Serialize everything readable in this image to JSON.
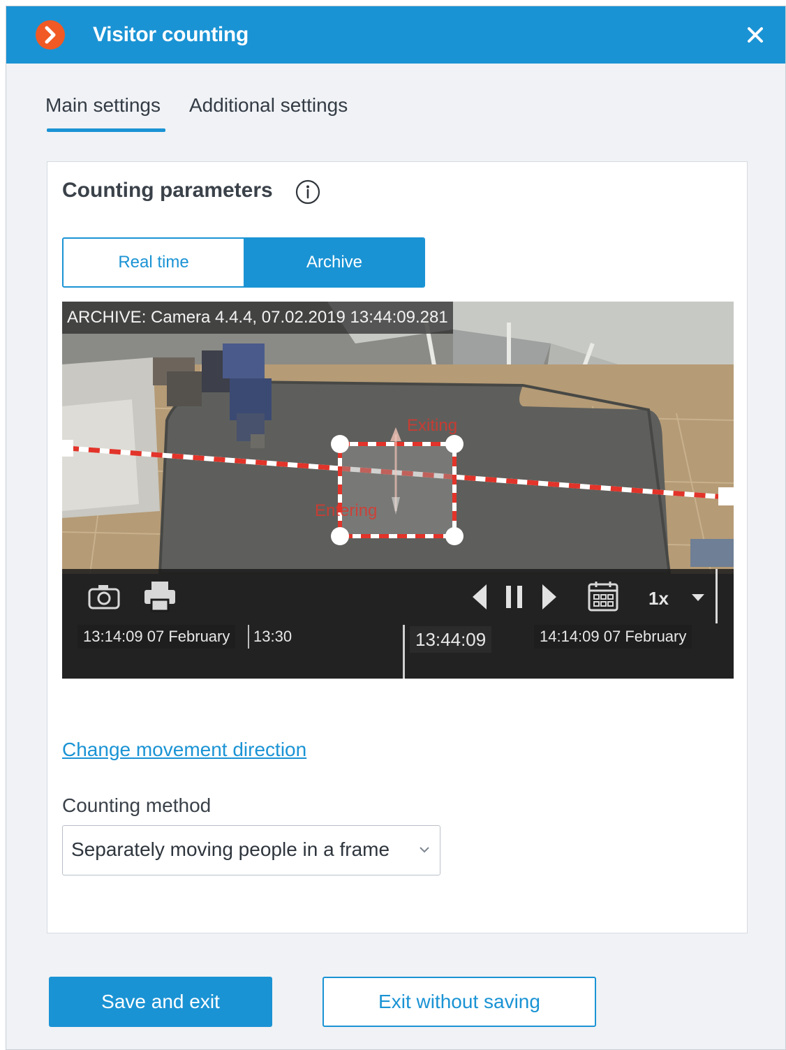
{
  "window": {
    "title": "Visitor counting",
    "accent_color": "#1a93d4",
    "logo_color": "#f15a24",
    "close_icon": "close-icon"
  },
  "tabs": [
    {
      "label": "Main settings",
      "active": true
    },
    {
      "label": "Additional settings",
      "active": false
    }
  ],
  "panel": {
    "title": "Counting parameters",
    "info_icon": "info-icon"
  },
  "mode_toggle": {
    "options": [
      {
        "label": "Real time",
        "selected": false
      },
      {
        "label": "Archive",
        "selected": true
      }
    ]
  },
  "video": {
    "camera_label": "ARCHIVE: Camera 4.4.4, 07.02.2019 13:44:09.281",
    "zone_exit_label": "Exiting",
    "zone_enter_label": "Entering",
    "line_color": "#e2342a",
    "controls": {
      "icons": [
        "camera-icon",
        "print-icon",
        "prev-frame-icon",
        "pause-icon",
        "next-frame-icon",
        "calendar-icon",
        "speed-dropdown-icon"
      ],
      "speed": "1x"
    },
    "timeline": {
      "start": "13:14:09 07 February",
      "mark": "13:30",
      "current": "13:44:09",
      "end": "14:14:09 07 February"
    }
  },
  "change_direction_link": "Change movement direction",
  "counting_method": {
    "label": "Counting method",
    "value": "Separately moving people in a frame"
  },
  "footer": {
    "save_label": "Save and exit",
    "exit_label": "Exit without saving"
  }
}
